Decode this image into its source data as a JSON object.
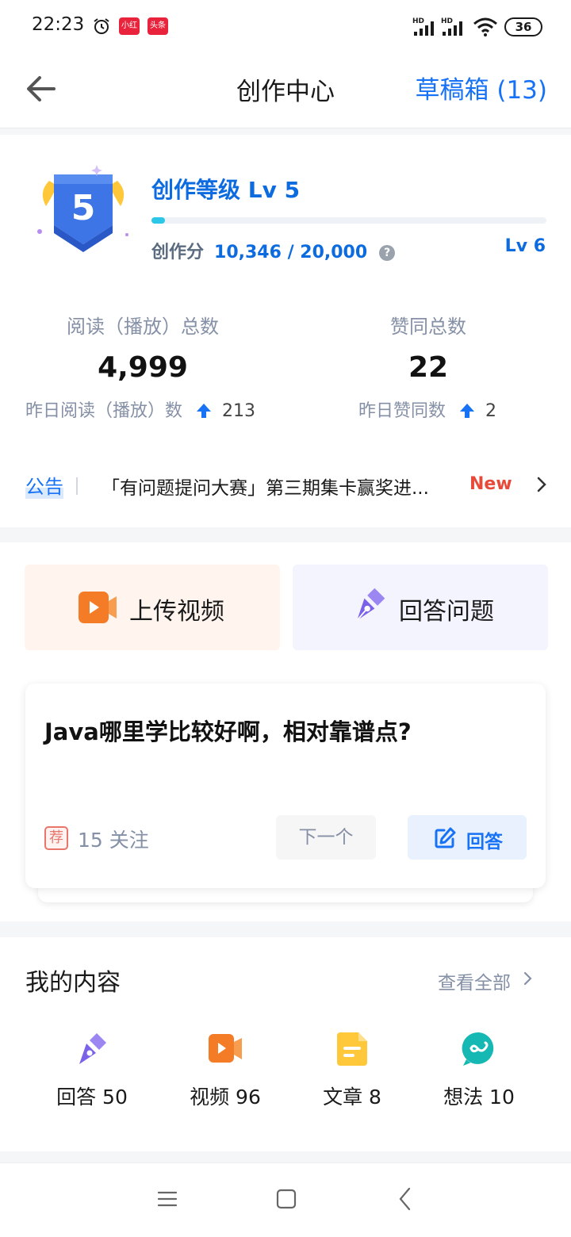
{
  "status_bar": {
    "time": "22:23",
    "app_badges": [
      "小红书",
      "头条"
    ],
    "battery": "36",
    "icons": [
      "alarm-icon",
      "signal-hd-icon",
      "signal-hd-icon",
      "wifi-icon",
      "battery-icon"
    ]
  },
  "header": {
    "title": "创作中心",
    "drafts_label": "草稿箱 (13)",
    "back_icon": "arrow-left-icon"
  },
  "level": {
    "badge_number": "5",
    "title": "创作等级  Lv 5",
    "progress_fraction": 0.035,
    "score_label": "创作分",
    "score_value": "10,346 / 20,000",
    "next_level": "Lv 6"
  },
  "stats": {
    "reads": {
      "label": "阅读（播放）总数",
      "value": "4,999",
      "yesterday_label": "昨日阅读（播放）数",
      "yesterday_value": "213"
    },
    "likes": {
      "label": "赞同总数",
      "value": "22",
      "yesterday_label": "昨日赞同数",
      "yesterday_value": "2"
    }
  },
  "notice": {
    "tag": "公告",
    "text": "「有问题提问大赛」第三期集卡赢奖进...",
    "new_badge": "New"
  },
  "actions": {
    "upload_video": "上传视频",
    "answer_question": "回答问题"
  },
  "question_card": {
    "title": "Java哪里学比较好啊，相对靠谱点?",
    "rec_badge": "荐",
    "follow_count": "15 关注",
    "next_label": "下一个",
    "answer_label": "回答"
  },
  "my_content": {
    "title": "我的内容",
    "view_all": "查看全部",
    "items": [
      {
        "label": "回答 50",
        "icon": "pen-icon"
      },
      {
        "label": "视频 96",
        "icon": "video-icon"
      },
      {
        "label": "文章 8",
        "icon": "article-icon"
      },
      {
        "label": "想法 10",
        "icon": "idea-icon"
      }
    ]
  },
  "colors": {
    "accent": "#1772f6",
    "level_blue": "#0d6be0",
    "progress": "#2bc6e8",
    "new_red": "#e84a3a",
    "upload_orange": "#f57c27",
    "pen_purple": "#7b62e8",
    "article_yellow": "#ffc83a",
    "idea_teal": "#16b8b3"
  },
  "navbar": {
    "icons": [
      "menu-icon",
      "home-square-icon",
      "back-triangle-icon"
    ]
  }
}
